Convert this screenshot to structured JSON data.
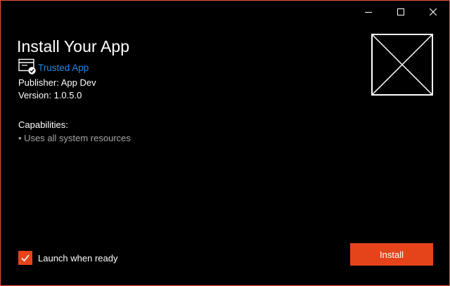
{
  "window": {
    "title": "Install Your App",
    "border_color": "#e8543a",
    "background": "#000000"
  },
  "caption_buttons": [
    {
      "name": "minimize",
      "icon": "minimize-icon"
    },
    {
      "name": "maximize",
      "icon": "maximize-icon"
    },
    {
      "name": "close",
      "icon": "close-icon"
    }
  ],
  "trust": {
    "icon": "certificate-check-icon",
    "label": "Trusted App",
    "link_color": "#1a8ae6"
  },
  "details": {
    "publisher": "Publisher: App Dev",
    "version": "Version: 1.0.5.0"
  },
  "capabilities": {
    "heading": "Capabilities:",
    "items": [
      "• Uses all system resources"
    ]
  },
  "logo": {
    "icon": "placeholder-logo-icon"
  },
  "launch": {
    "label": "Launch when ready",
    "checked": true,
    "accent": "#e5441b"
  },
  "install": {
    "label": "Install",
    "accent": "#e5441b"
  }
}
